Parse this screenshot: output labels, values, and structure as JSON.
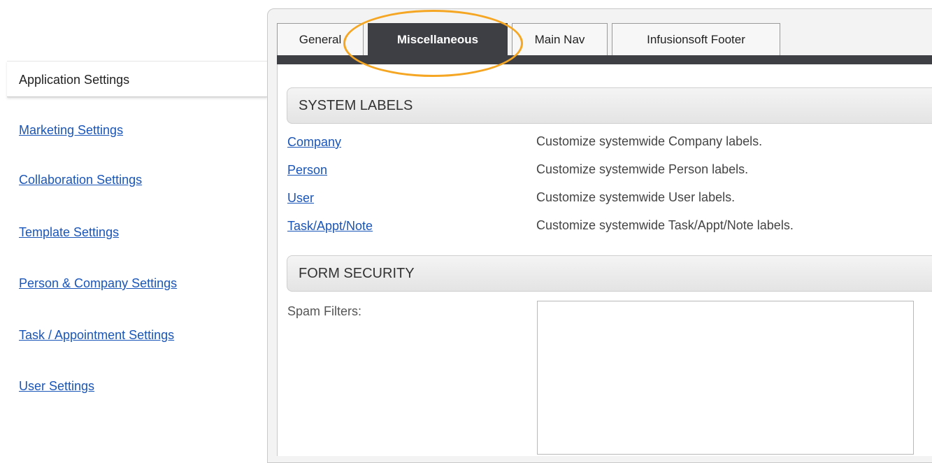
{
  "sidebar": {
    "active_label": "Application Settings",
    "links": [
      "Marketing Settings",
      "Collaboration Settings",
      "Template Settings",
      "Person & Company Settings",
      "Task / Appointment Settings",
      "User Settings"
    ]
  },
  "tabs": [
    "General",
    "Miscellaneous",
    "Main Nav",
    "Infusionsoft Footer"
  ],
  "active_tab": "Miscellaneous",
  "system_labels": {
    "title": "SYSTEM LABELS",
    "rows": [
      {
        "label": "Company",
        "description": "Customize systemwide Company labels."
      },
      {
        "label": "Person",
        "description": "Customize systemwide Person labels."
      },
      {
        "label": "User",
        "description": "Customize systemwide User labels."
      },
      {
        "label": "Task/Appt/Note",
        "description": "Customize systemwide Task/Appt/Note labels."
      }
    ]
  },
  "form_security": {
    "title": "FORM SECURITY",
    "spam_label": "Spam Filters:",
    "spam_value": ""
  },
  "colors": {
    "link": "#1a55b8",
    "active_tab_bg": "#3d3f44",
    "highlight": "#f5a623"
  }
}
